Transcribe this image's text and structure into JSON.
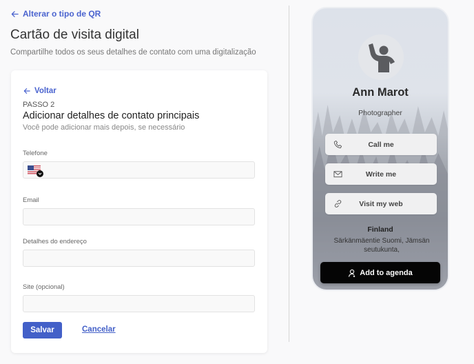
{
  "header": {
    "back_link": "Alterar o tipo de QR",
    "title": "Cartão de visita digital",
    "subtitle": "Compartilhe todos os seus detalhes de contato com uma digitalização"
  },
  "form": {
    "back": "Voltar",
    "step": "PASSO 2",
    "title": "Adicionar detalhes de contato principais",
    "subtitle": "Você pode adicionar mais depois, se necessário",
    "fields": [
      {
        "label": "Telefone",
        "value": "",
        "placeholder": "",
        "country_flag": "US"
      },
      {
        "label": "Email",
        "value": "",
        "placeholder": ""
      },
      {
        "label": "Detalhes do endereço",
        "value": "",
        "placeholder": ""
      },
      {
        "label": "Site (opcional)",
        "value": "",
        "placeholder": ""
      }
    ],
    "save_label": "Salvar",
    "cancel_label": "Cancelar"
  },
  "preview": {
    "name": "Ann Marot",
    "role": "Photographer",
    "actions": [
      {
        "label": "Call me",
        "icon": "phone-icon"
      },
      {
        "label": "Write me",
        "icon": "mail-icon"
      },
      {
        "label": "Visit my web",
        "icon": "link-icon"
      }
    ],
    "country": "Finland",
    "address": "Särkänmäentie Suomi, Jämsän seutukunta,",
    "agenda_label": "Add to agenda"
  },
  "colors": {
    "accent": "#4360c8",
    "link": "#4a63cf",
    "background": "#f9f9fa",
    "agenda_button": "#050505"
  }
}
